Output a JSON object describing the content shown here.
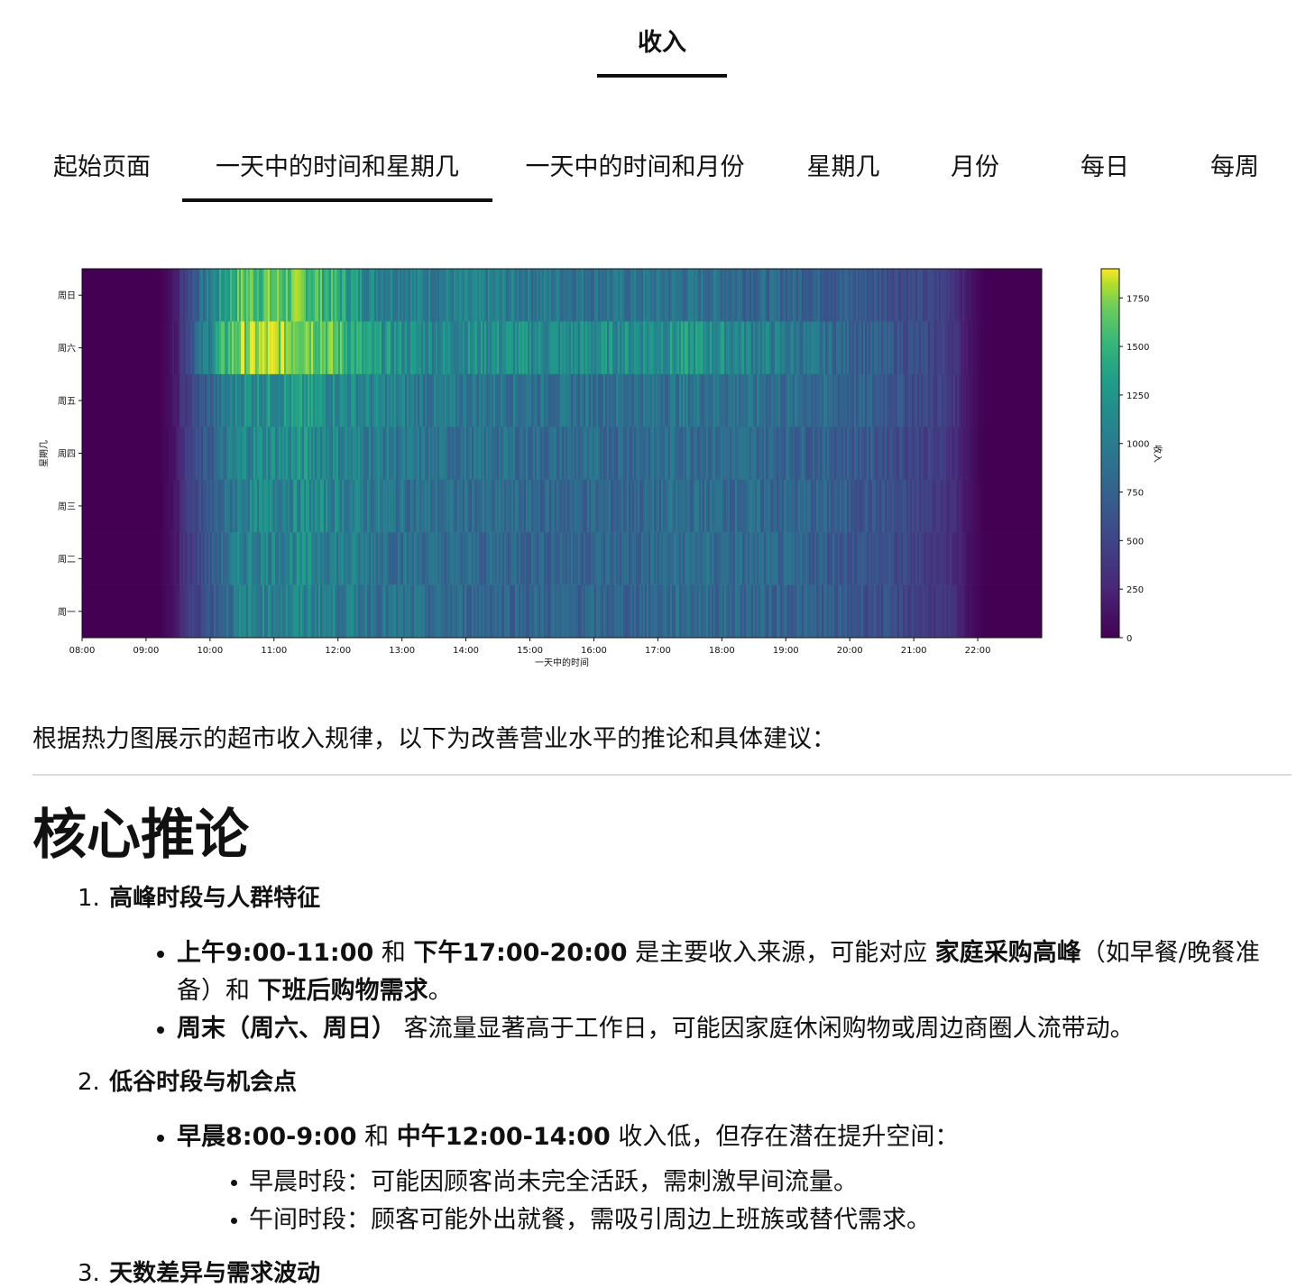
{
  "top_tab": {
    "label": "收入"
  },
  "tabs": [
    {
      "label": "起始页面",
      "active": false
    },
    {
      "label": "一天中的时间和星期几",
      "active": true
    },
    {
      "label": "一天中的时间和月份",
      "active": false
    },
    {
      "label": "星期几",
      "active": false
    },
    {
      "label": "月份",
      "active": false
    },
    {
      "label": "每日",
      "active": false
    },
    {
      "label": "每周",
      "active": false
    }
  ],
  "chart_data": {
    "type": "heatmap",
    "xlabel": "一天中的时间",
    "ylabel": "星期几",
    "colorbar_label": "收入",
    "colormap": "viridis",
    "color_range": [
      0,
      1900
    ],
    "colorbar_ticks": [
      0,
      250,
      500,
      750,
      1000,
      1250,
      1500,
      1750
    ],
    "x_ticks": [
      "08:00",
      "09:00",
      "10:00",
      "11:00",
      "12:00",
      "13:00",
      "14:00",
      "15:00",
      "16:00",
      "17:00",
      "18:00",
      "19:00",
      "20:00",
      "21:00",
      "22:00"
    ],
    "x_range": [
      "08:00",
      "23:00"
    ],
    "y_categories": [
      "周日",
      "周六",
      "周五",
      "周四",
      "周三",
      "周二",
      "周一"
    ],
    "hours": [
      8,
      9,
      10,
      11,
      12,
      13,
      14,
      15,
      16,
      17,
      18,
      19,
      20,
      21,
      22
    ],
    "rows": [
      {
        "day": "周日",
        "values": [
          0,
          280,
          1400,
          1400,
          900,
          800,
          800,
          750,
          720,
          720,
          650,
          600,
          500,
          350,
          40
        ]
      },
      {
        "day": "周六",
        "values": [
          0,
          280,
          1600,
          1650,
          1000,
          900,
          950,
          900,
          950,
          1000,
          850,
          700,
          550,
          350,
          40
        ]
      },
      {
        "day": "周五",
        "values": [
          0,
          250,
          950,
          1000,
          850,
          750,
          750,
          700,
          700,
          750,
          700,
          650,
          550,
          350,
          30
        ]
      },
      {
        "day": "周四",
        "values": [
          0,
          250,
          900,
          950,
          800,
          700,
          700,
          650,
          650,
          700,
          650,
          600,
          500,
          300,
          30
        ]
      },
      {
        "day": "周三",
        "values": [
          0,
          230,
          850,
          900,
          780,
          680,
          650,
          620,
          620,
          680,
          650,
          600,
          480,
          300,
          30
        ]
      },
      {
        "day": "周二",
        "values": [
          0,
          230,
          850,
          880,
          760,
          660,
          640,
          620,
          620,
          680,
          640,
          580,
          470,
          280,
          30
        ]
      },
      {
        "day": "周一",
        "values": [
          0,
          230,
          830,
          860,
          750,
          650,
          640,
          610,
          610,
          670,
          630,
          570,
          460,
          280,
          30
        ]
      }
    ]
  },
  "intro": "根据热力图展示的超市收入规律，以下为改善营业水平的推论和具体建议：",
  "section_title": "核心推论",
  "points": [
    {
      "num": "1.",
      "head": "高峰时段与人群特征",
      "bullets": [
        {
          "b1": "上午9:00-11:00",
          "t1": " 和 ",
          "b2": "下午17:00-20:00",
          "t2": " 是主要收入来源，可能对应 ",
          "b3": "家庭采购高峰",
          "t3": "（如早餐/晚餐准备）和 ",
          "b4": "下班后购物需求",
          "t4": "。"
        },
        {
          "b1": "周末（周六、周日）",
          "t1": " 客流量显著高于工作日，可能因家庭休闲购物或周边商圈人流带动。"
        }
      ]
    },
    {
      "num": "2.",
      "head": "低谷时段与机会点",
      "bullets": [
        {
          "b1": "早晨8:00-9:00",
          "t1": " 和 ",
          "b2": "中午12:00-14:00",
          "t2": " 收入低，但存在潜在提升空间："
        }
      ],
      "sub_bullets": [
        "早晨时段：可能因顾客尚未完全活跃，需刺激早间流量。",
        "午间时段：顾客可能外出就餐，需吸引周边上班族或替代需求。"
      ]
    },
    {
      "num": "3.",
      "head": "天数差异与需求波动"
    }
  ]
}
